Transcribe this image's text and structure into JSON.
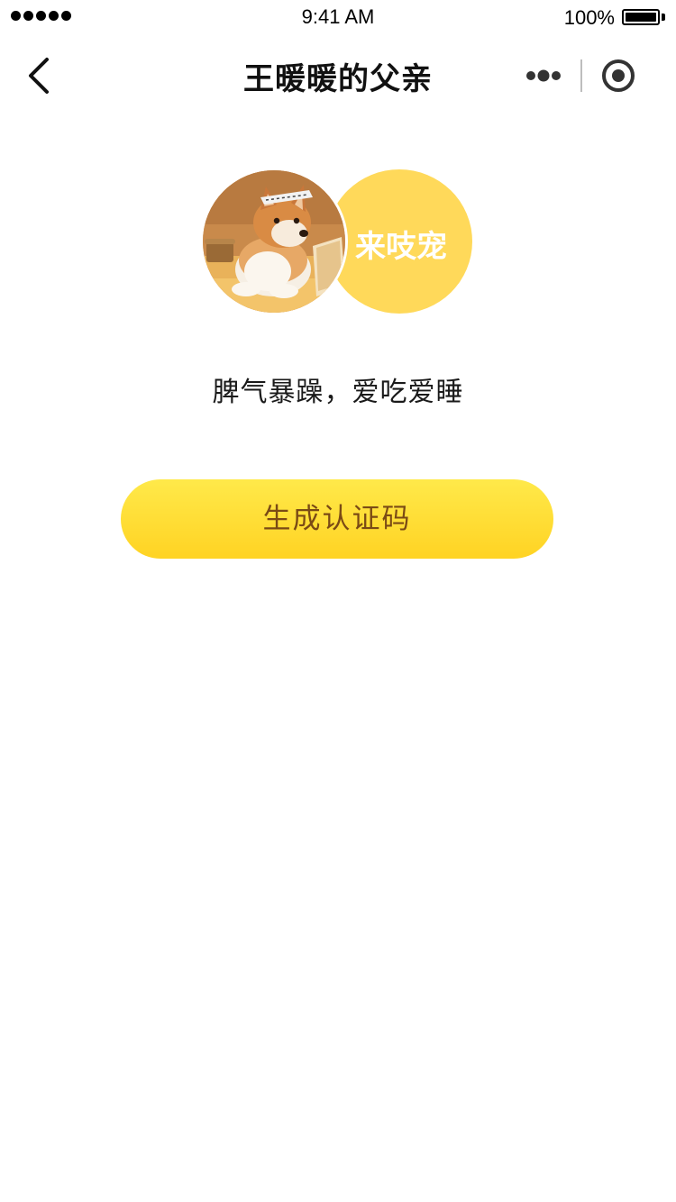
{
  "status_bar": {
    "time": "9:41 AM",
    "battery_text": "100%",
    "battery_level": 1.0
  },
  "nav": {
    "title": "王暖暖的父亲",
    "back_icon": "chevron-left-icon",
    "more_icon": "more-dots-icon",
    "close_icon": "target-close-icon"
  },
  "profile": {
    "brand_text": "来吱宠",
    "brand_color": "#ffd95a",
    "description": "脾气暴躁，爱吃爱睡"
  },
  "actions": {
    "generate_label": "生成认证码",
    "button_gradient_top": "#ffe94a",
    "button_gradient_bottom": "#ffd323",
    "button_text_color": "#7a4a15"
  }
}
